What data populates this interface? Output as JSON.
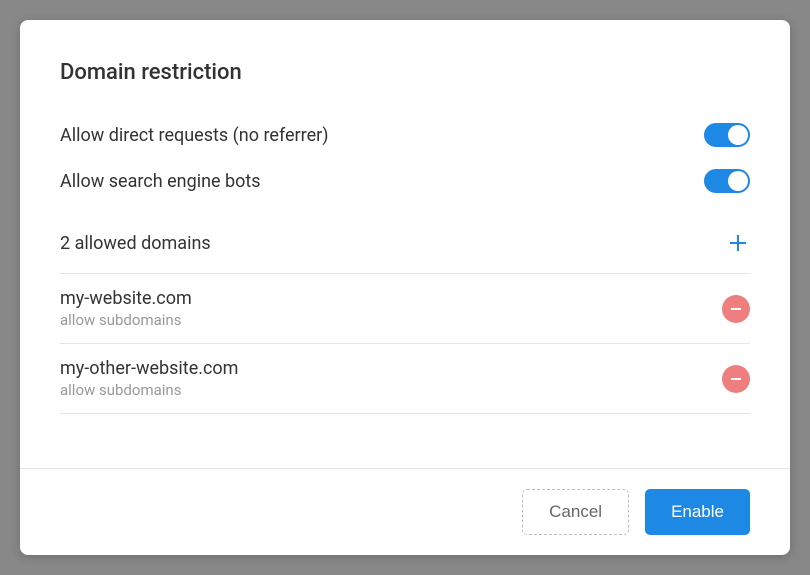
{
  "colors": {
    "accent": "#1e88e5",
    "danger": "#ef7f7f"
  },
  "title": "Domain restriction",
  "toggles": [
    {
      "label": "Allow direct requests (no referrer)",
      "on": true
    },
    {
      "label": "Allow search engine bots",
      "on": true
    }
  ],
  "domains": {
    "header": "2 allowed domains",
    "add_icon": "plus-icon",
    "items": [
      {
        "name": "my-website.com",
        "sub": "allow subdomains",
        "remove_icon": "minus-icon"
      },
      {
        "name": "my-other-website.com",
        "sub": "allow subdomains",
        "remove_icon": "minus-icon"
      }
    ]
  },
  "actions": {
    "cancel": "Cancel",
    "enable": "Enable"
  }
}
